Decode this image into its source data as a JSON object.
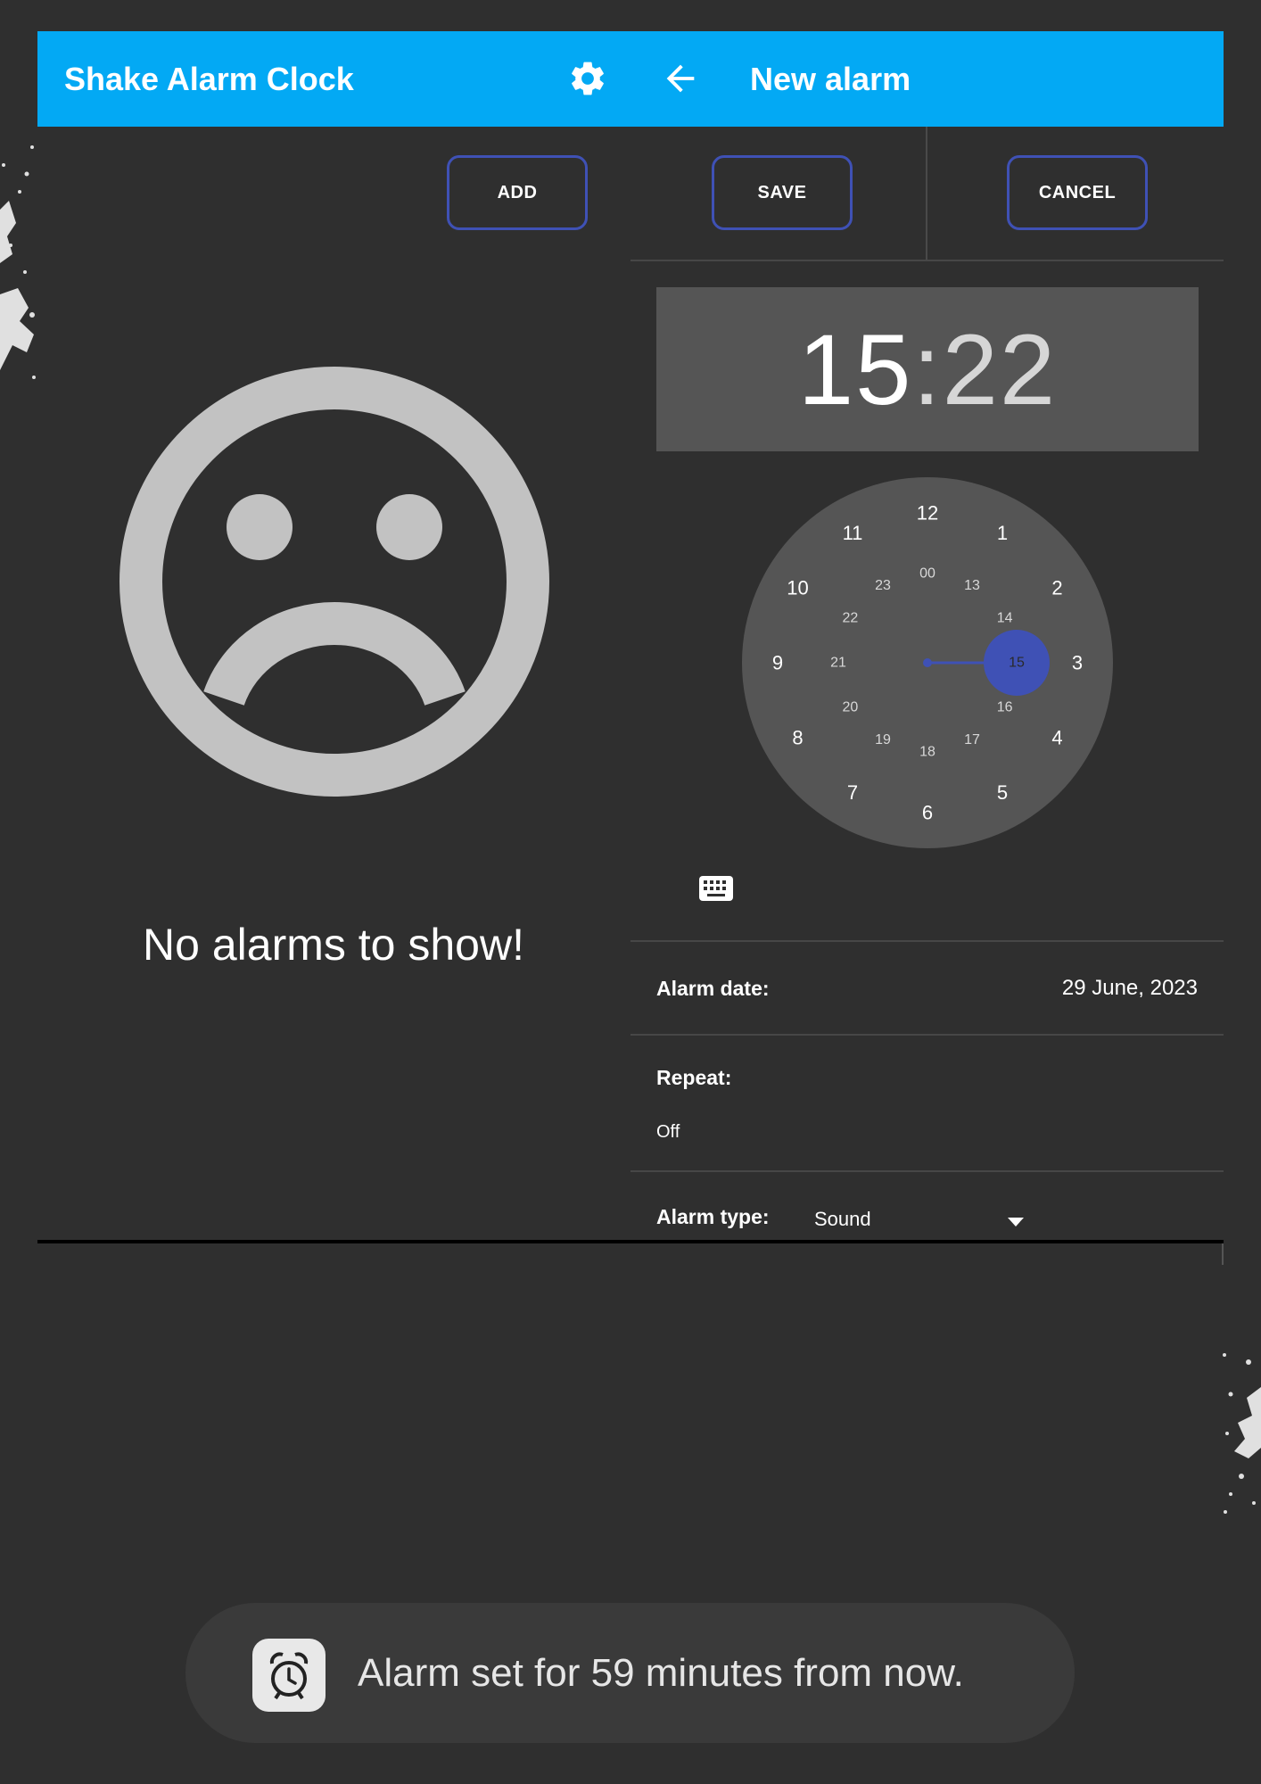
{
  "header": {
    "app_title": "Shake Alarm Clock",
    "new_alarm_title": "New alarm",
    "color": "#03a9f4"
  },
  "icons": {
    "settings": "gear-icon",
    "back": "arrow-left-icon",
    "keyboard": "keyboard-icon",
    "dropdown": "caret-down-icon",
    "empty_state": "sad-face-icon",
    "toast": "alarm-clock-icon"
  },
  "list_panel": {
    "add_label": "ADD",
    "empty_message": "No alarms to show!"
  },
  "editor": {
    "save_label": "SAVE",
    "cancel_label": "CANCEL",
    "time": {
      "hours": "15",
      "separator": ":",
      "minutes": "22"
    },
    "clock": {
      "outer_numbers": [
        "12",
        "1",
        "2",
        "3",
        "4",
        "5",
        "6",
        "7",
        "8",
        "9",
        "10",
        "11"
      ],
      "inner_numbers": [
        "00",
        "13",
        "14",
        "15",
        "16",
        "17",
        "18",
        "19",
        "20",
        "21",
        "22",
        "23"
      ],
      "selected": "15",
      "accent_color": "#3f51b5"
    },
    "alarm_date_label": "Alarm date:",
    "alarm_date_value": "29 June, 2023",
    "repeat_label": "Repeat:",
    "repeat_value": "Off",
    "alarm_type_label": "Alarm type:",
    "alarm_type_value": "Sound"
  },
  "toast": {
    "message": "Alarm set for 59 minutes from now."
  }
}
